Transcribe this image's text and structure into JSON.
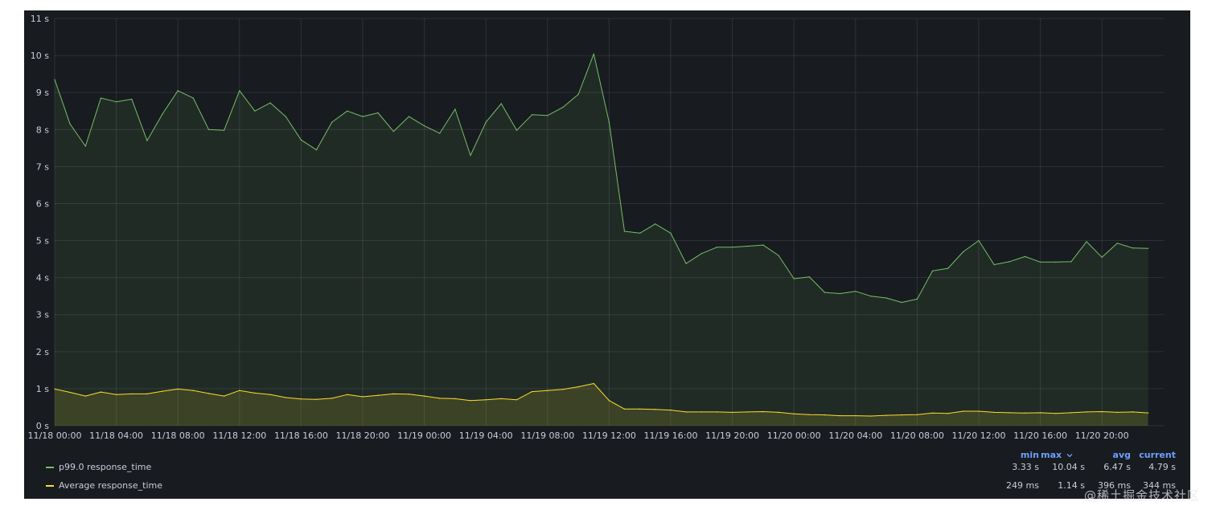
{
  "chart_data": {
    "type": "area",
    "xlabel": "",
    "ylabel": "",
    "ylim": [
      0,
      11
    ],
    "grid": true,
    "legend_position": "bottom",
    "y_ticks": [
      "0 s",
      "1 s",
      "2 s",
      "3 s",
      "4 s",
      "5 s",
      "6 s",
      "7 s",
      "8 s",
      "9 s",
      "10 s",
      "11 s"
    ],
    "x_ticks": [
      "11/18 00:00",
      "11/18 04:00",
      "11/18 08:00",
      "11/18 12:00",
      "11/18 16:00",
      "11/18 20:00",
      "11/19 00:00",
      "11/19 04:00",
      "11/19 08:00",
      "11/19 12:00",
      "11/19 16:00",
      "11/19 20:00",
      "11/20 00:00",
      "11/20 04:00",
      "11/20 08:00",
      "11/20 12:00",
      "11/20 16:00",
      "11/20 20:00"
    ],
    "x_start": "11/18 00:00",
    "x_end": "11/20 23:00",
    "x_step_minutes": 60,
    "series": [
      {
        "name": "p99.0 response_time",
        "color": "#73bf69",
        "values": [
          9.35,
          8.15,
          7.55,
          8.85,
          8.75,
          8.82,
          7.7,
          8.42,
          9.05,
          8.85,
          8.0,
          7.98,
          9.05,
          8.5,
          8.72,
          8.35,
          7.72,
          7.45,
          8.2,
          8.5,
          8.35,
          8.45,
          7.95,
          8.35,
          8.1,
          7.9,
          8.55,
          7.3,
          8.2,
          8.7,
          7.98,
          8.4,
          8.38,
          8.6,
          8.95,
          10.04,
          8.2,
          5.25,
          5.2,
          5.45,
          5.2,
          4.38,
          4.65,
          4.82,
          4.82,
          4.85,
          4.88,
          4.6,
          3.97,
          4.02,
          3.6,
          3.57,
          3.63,
          3.5,
          3.45,
          3.33,
          3.42,
          4.18,
          4.25,
          4.7,
          5.0,
          4.35,
          4.43,
          4.57,
          4.42,
          4.42,
          4.43,
          4.97,
          4.55,
          4.93,
          4.8,
          4.79
        ]
      },
      {
        "name": "Average response_time",
        "color": "#fade2a",
        "values": [
          0.99,
          0.9,
          0.8,
          0.91,
          0.84,
          0.86,
          0.86,
          0.93,
          0.99,
          0.95,
          0.87,
          0.8,
          0.95,
          0.88,
          0.84,
          0.76,
          0.72,
          0.71,
          0.74,
          0.84,
          0.78,
          0.82,
          0.86,
          0.85,
          0.8,
          0.74,
          0.73,
          0.68,
          0.7,
          0.73,
          0.7,
          0.92,
          0.95,
          0.98,
          1.05,
          1.14,
          0.68,
          0.45,
          0.45,
          0.44,
          0.42,
          0.37,
          0.37,
          0.37,
          0.36,
          0.37,
          0.38,
          0.36,
          0.32,
          0.3,
          0.29,
          0.27,
          0.27,
          0.26,
          0.28,
          0.29,
          0.3,
          0.34,
          0.33,
          0.39,
          0.39,
          0.36,
          0.35,
          0.34,
          0.35,
          0.33,
          0.35,
          0.37,
          0.38,
          0.36,
          0.37,
          0.344
        ]
      }
    ]
  },
  "legend": {
    "headers": {
      "min": "min",
      "max": "max",
      "avg": "avg",
      "current": "current"
    },
    "sort_indicator": "chevron-down-icon",
    "rows": [
      {
        "name": "p99.0 response_time",
        "color": "#73bf69",
        "min": "3.33 s",
        "max": "10.04 s",
        "avg": "6.47 s",
        "current": "4.79 s"
      },
      {
        "name": "Average response_time",
        "color": "#fade2a",
        "min": "249 ms",
        "max": "1.14 s",
        "avg": "396 ms",
        "current": "344 ms"
      }
    ]
  },
  "watermark": "@稀土掘金技术社区"
}
